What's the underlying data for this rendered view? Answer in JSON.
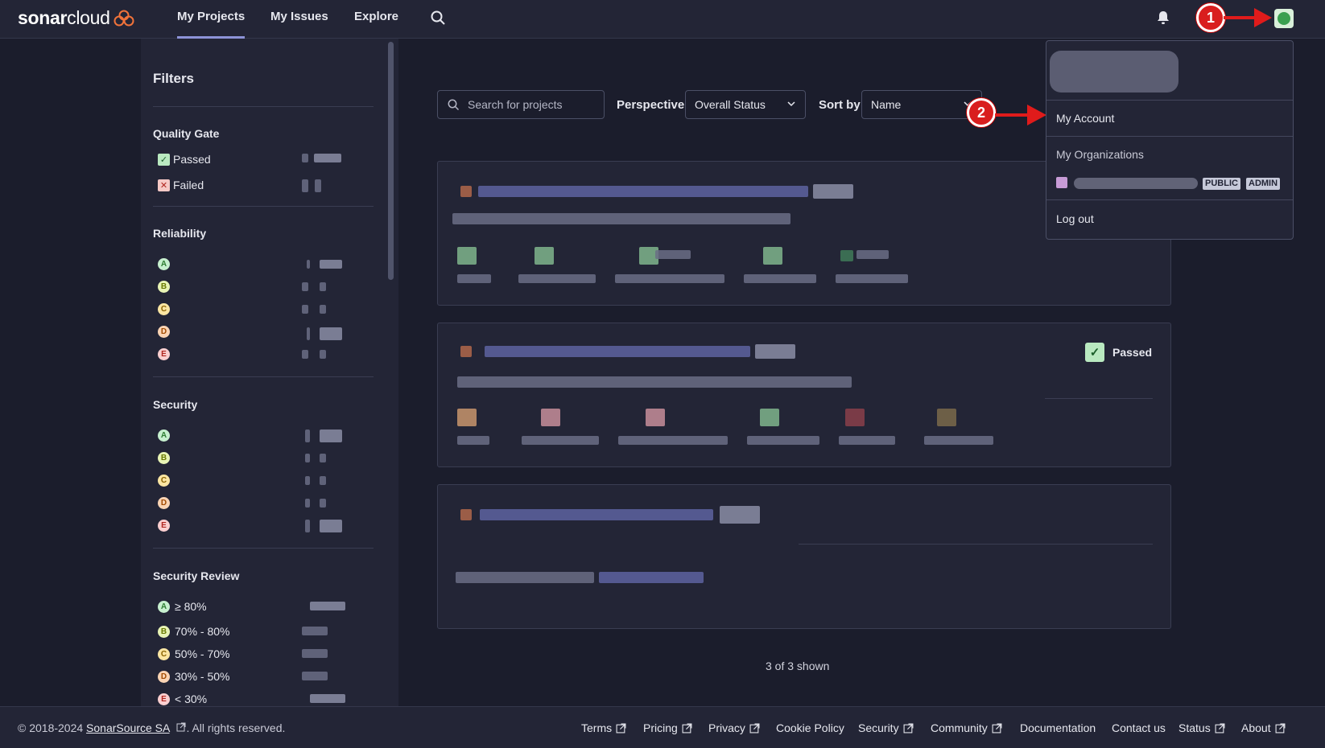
{
  "nav": {
    "logo_bold": "sonar",
    "logo_light": "cloud",
    "links": [
      "My Projects",
      "My Issues",
      "Explore"
    ],
    "active": "My Projects"
  },
  "callouts": [
    "1",
    "2"
  ],
  "filters": {
    "title": "Filters",
    "quality_gate": {
      "title": "Quality Gate",
      "options": [
        "Passed",
        "Failed"
      ]
    },
    "reliability": {
      "title": "Reliability",
      "grades": [
        "A",
        "B",
        "C",
        "D",
        "E"
      ]
    },
    "security": {
      "title": "Security",
      "grades": [
        "A",
        "B",
        "C",
        "D",
        "E"
      ]
    },
    "security_review": {
      "title": "Security Review",
      "grades": [
        "A",
        "B",
        "C",
        "D",
        "E"
      ],
      "labels": [
        "≥ 80%",
        "70% - 80%",
        "50% - 70%",
        "30% - 50%",
        "< 30%"
      ]
    }
  },
  "toolbar": {
    "search_placeholder": "Search for projects",
    "perspective_label": "Perspective",
    "perspective_value": "Overall Status",
    "sort_label": "Sort by",
    "sort_value": "Name"
  },
  "project_cards": [
    {
      "status": ""
    },
    {
      "status": "Passed"
    },
    {
      "status": ""
    }
  ],
  "shown_count": "3 of 3 shown",
  "account_menu": {
    "my_account": "My Account",
    "my_organizations": "My Organizations",
    "org_tags": [
      "PUBLIC",
      "ADMIN"
    ],
    "logout": "Log out"
  },
  "footer": {
    "copyright_prefix": "© 2018-2024",
    "company": "SonarSource SA",
    "copyright_suffix": ". All rights reserved.",
    "links": [
      "Terms",
      "Pricing",
      "Privacy",
      "Cookie Policy",
      "Security",
      "Community",
      "Documentation",
      "Contact us",
      "Status",
      "About"
    ]
  },
  "colors": {
    "accent": "#8d93d8",
    "callout": "#d91e1e",
    "background": "#1b1d2c",
    "panel": "#232536"
  }
}
